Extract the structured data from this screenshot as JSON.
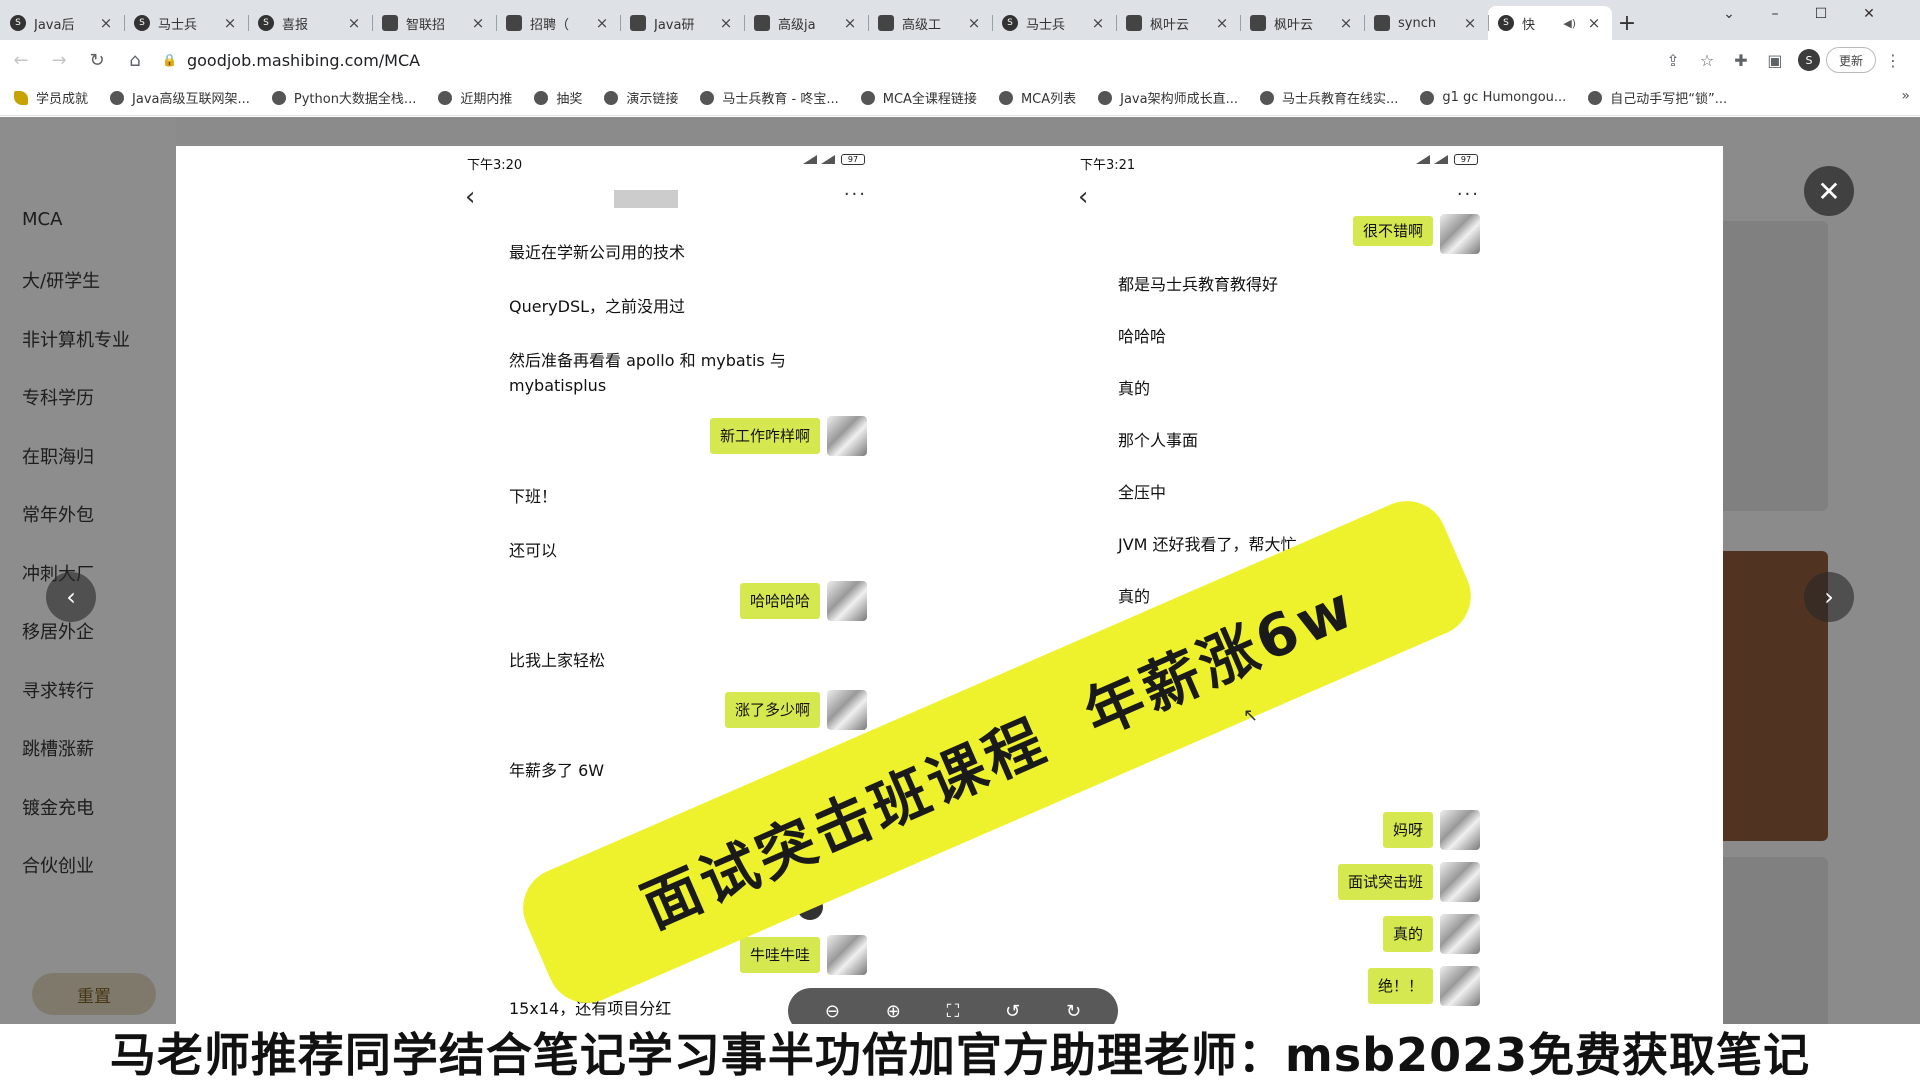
{
  "browser": {
    "tabs": [
      {
        "title": "Java后",
        "icon": "mashibing-icon"
      },
      {
        "title": "马士兵",
        "icon": "mashibing-icon"
      },
      {
        "title": "喜报",
        "icon": "mashibing-icon"
      },
      {
        "title": "智联招",
        "icon": "page-icon"
      },
      {
        "title": "招聘（",
        "icon": "page-icon"
      },
      {
        "title": "Java研",
        "icon": "page-icon"
      },
      {
        "title": "高级ja",
        "icon": "page-icon"
      },
      {
        "title": "高级工",
        "icon": "page-icon"
      },
      {
        "title": "马士兵",
        "icon": "mashibing-icon"
      },
      {
        "title": "枫叶云",
        "icon": "page-icon"
      },
      {
        "title": "枫叶云",
        "icon": "page-icon"
      },
      {
        "title": "synch",
        "icon": "page-icon"
      },
      {
        "title": "快",
        "icon": "mashibing-icon",
        "active": true
      }
    ],
    "url": "goodjob.mashibing.com/MCA",
    "profile_initial": "S",
    "update_label": "更新",
    "bookmarks": [
      "学员成就",
      "Java高级互联网架...",
      "Python大数据全栈...",
      "近期内推",
      "抽奖",
      "演示链接",
      "马士兵教育 - 咚宝...",
      "MCA全课程链接",
      "MCA列表",
      "Java架构师成长直...",
      "马士兵教育在线实...",
      "g1 gc Humongou...",
      "自己动手写把“锁”..."
    ]
  },
  "sidebar": {
    "items": [
      "MCA",
      "大/研学生",
      "非计算机专业",
      "专科学历",
      "在职海归",
      "常年外包",
      "冲刺大厂",
      "移居外企",
      "寻求转行",
      "跳槽涨薪",
      "镀金充电",
      "合伙创业"
    ],
    "reset_label": "重置"
  },
  "chat_left": {
    "time": "下午3:20",
    "battery": "97",
    "messages": [
      "最近在学新公司用的技术",
      "QueryDSL，之前没用过",
      "然后准备再看看 apollo 和 mybatis 与 mybatisplus",
      "新工作咋样啊",
      "下班！",
      "还可以",
      "哈哈哈哈",
      "比我上家轻松",
      "涨了多少啊",
      "年薪多了 6W",
      "牛哇牛哇",
      "15x14，还有项目分红"
    ]
  },
  "chat_right": {
    "time": "下午3:21",
    "battery": "97",
    "messages": [
      "很不错啊",
      "都是马士兵教育教得好",
      "哈哈哈",
      "真的",
      "那个人事面",
      "全压中",
      "JVM 还好我看了，帮大忙",
      "真的",
      "妈呀",
      "面试突击班",
      "真的",
      "绝！！"
    ]
  },
  "banner": {
    "part1": "面试突击班课程",
    "part2": "年薪涨6w"
  },
  "subtitle": "马老师推荐同学结合笔记学习事半功倍加官方助理老师：msb2023免费获取笔记"
}
